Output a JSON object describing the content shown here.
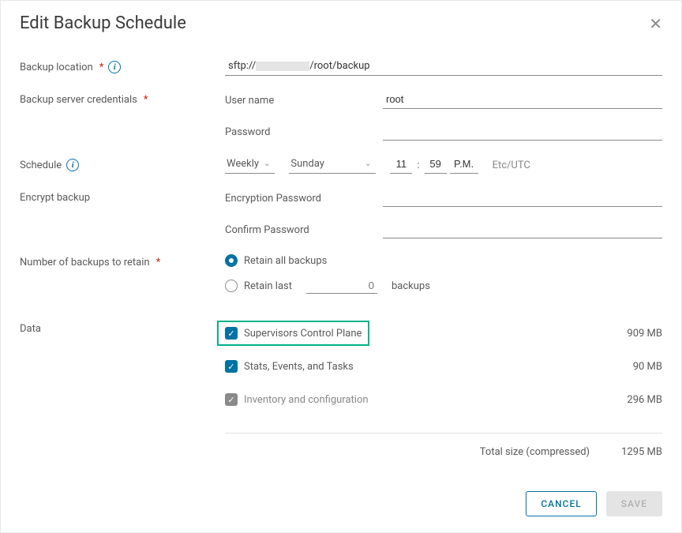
{
  "dialog": {
    "title": "Edit Backup Schedule"
  },
  "labels": {
    "backup_location": "Backup location",
    "credentials": "Backup server credentials",
    "username": "User name",
    "password": "Password",
    "schedule": "Schedule",
    "encrypt": "Encrypt backup",
    "enc_password": "Encryption Password",
    "conf_password": "Confirm Password",
    "retain": "Number of backups to retain",
    "data": "Data"
  },
  "location": {
    "prefix": "sftp://",
    "suffix": "/root/backup"
  },
  "credentials": {
    "username": "root",
    "password": ""
  },
  "schedule": {
    "frequency": "Weekly",
    "day": "Sunday",
    "hour": "11",
    "minute": "59",
    "ampm": "P.M.",
    "timezone": "Etc/UTC"
  },
  "encrypt": {
    "password": "",
    "confirm": ""
  },
  "retain": {
    "option_all": "Retain all backups",
    "option_last": "Retain last",
    "backups_suffix": "backups",
    "last_value_placeholder": "0"
  },
  "data": {
    "items": [
      {
        "label": "Supervisors Control Plane",
        "size": "909 MB",
        "checked": true,
        "color": "blue",
        "highlight": true
      },
      {
        "label": "Stats, Events, and Tasks",
        "size": "90 MB",
        "checked": true,
        "color": "blue",
        "highlight": false
      },
      {
        "label": "Inventory and configuration",
        "size": "296 MB",
        "checked": true,
        "color": "grey",
        "highlight": false,
        "disabled": true
      }
    ],
    "total_label": "Total size (compressed)",
    "total_size": "1295 MB"
  },
  "buttons": {
    "cancel": "CANCEL",
    "save": "SAVE"
  }
}
